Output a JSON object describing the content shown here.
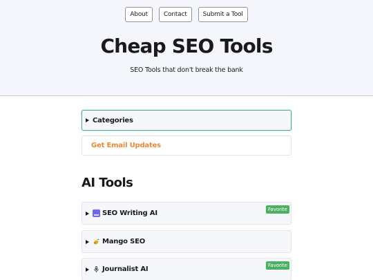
{
  "nav": {
    "about": "About",
    "contact": "Contact",
    "submit": "Submit a Tool"
  },
  "header": {
    "title": "Cheap SEO Tools",
    "subtitle": "SEO Tools that don't break the bank"
  },
  "categories": {
    "label": "Categories"
  },
  "email": {
    "label": "Get Email Updates"
  },
  "section": {
    "title": "AI Tools"
  },
  "tools": [
    {
      "name": "SEO Writing AI",
      "icon": "seo-writing-ai-logo",
      "badge": "Favorite"
    },
    {
      "name": "Mango SEO",
      "icon": "mango-icon",
      "badge": ""
    },
    {
      "name": "Journalist AI",
      "icon": "microphone-icon",
      "badge": "Favorite"
    }
  ],
  "colors": {
    "accent_link": "#e8893a",
    "badge": "#4caf62",
    "focus_border": "#5aa89a",
    "header_bg": "#f5f6fb"
  }
}
